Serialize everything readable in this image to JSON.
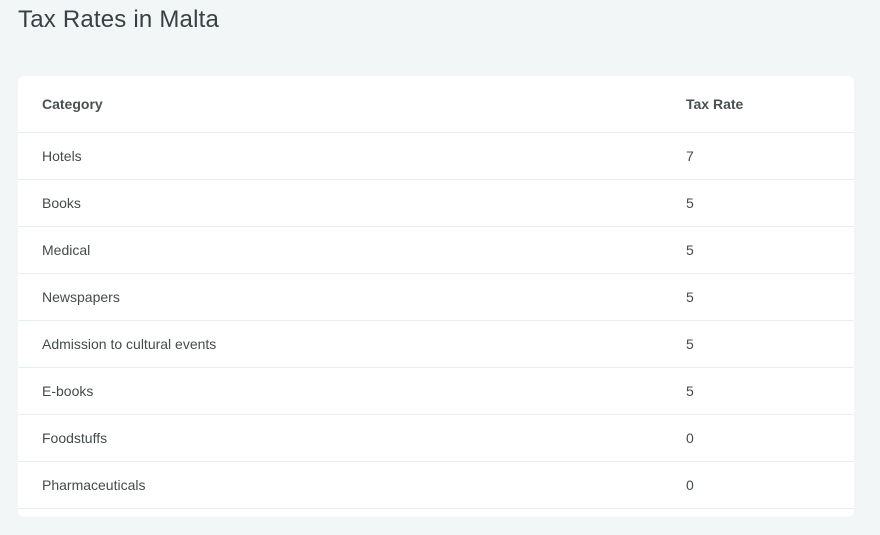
{
  "page": {
    "title": "Tax Rates in Malta"
  },
  "table": {
    "headers": {
      "category": "Category",
      "tax_rate": "Tax Rate"
    },
    "rows": [
      {
        "category": "Hotels",
        "tax_rate": "7"
      },
      {
        "category": "Books",
        "tax_rate": "5"
      },
      {
        "category": "Medical",
        "tax_rate": "5"
      },
      {
        "category": "Newspapers",
        "tax_rate": "5"
      },
      {
        "category": "Admission to cultural events",
        "tax_rate": "5"
      },
      {
        "category": "E-books",
        "tax_rate": "5"
      },
      {
        "category": "Foodstuffs",
        "tax_rate": "0"
      },
      {
        "category": "Pharmaceuticals",
        "tax_rate": "0"
      }
    ]
  }
}
